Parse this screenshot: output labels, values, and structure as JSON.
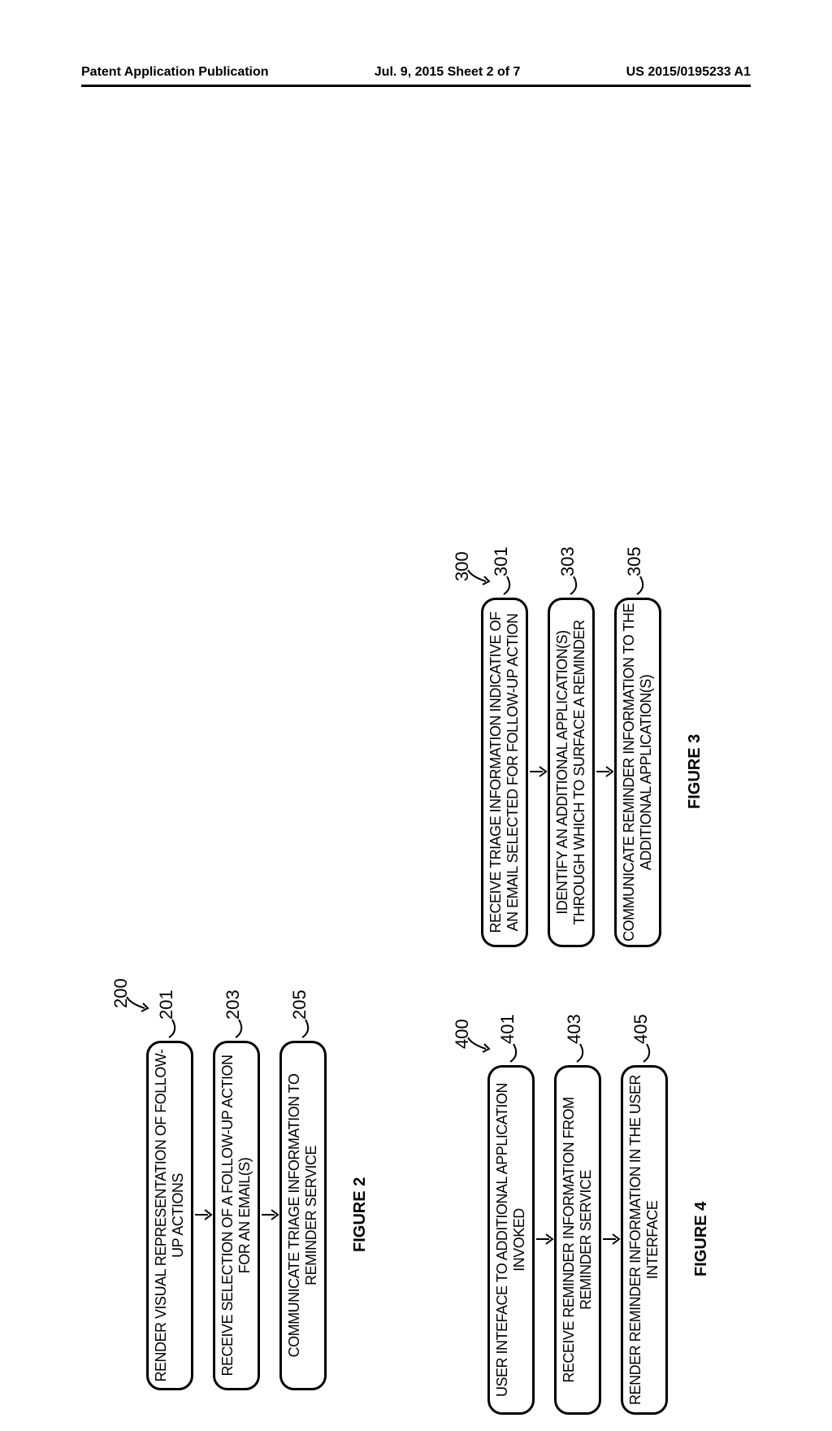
{
  "header": {
    "left": "Patent Application Publication",
    "center": "Jul. 9, 2015  Sheet 2 of 7",
    "right": "US 2015/0195233 A1"
  },
  "fig2": {
    "ref_num": "200",
    "title": "FIGURE 2",
    "steps": [
      {
        "num": "201",
        "text": "RENDER VISUAL REPRESENTATION OF FOLLOW-UP ACTIONS"
      },
      {
        "num": "203",
        "text": "RECEIVE SELECTION OF A FOLLOW-UP ACTION FOR AN EMAIL(S)"
      },
      {
        "num": "205",
        "text": "COMMUNICATE TRIAGE INFORMATION TO REMINDER SERVICE"
      }
    ]
  },
  "fig3": {
    "ref_num": "300",
    "title": "FIGURE 3",
    "steps": [
      {
        "num": "301",
        "text": "RECEIVE TRIAGE INFORMATION INDICATIVE OF AN EMAIL SELECTED FOR FOLLOW-UP ACTION"
      },
      {
        "num": "303",
        "text": "IDENTIFY AN ADDITIONAL APPLICATION(S) THROUGH WHICH TO SURFACE A REMINDER"
      },
      {
        "num": "305",
        "text": "COMMUNICATE REMINDER INFORMATION TO THE ADDITIONAL APPLICATION(S)"
      }
    ]
  },
  "fig4": {
    "ref_num": "400",
    "title": "FIGURE 4",
    "steps": [
      {
        "num": "401",
        "text": "USER INTEFACE TO ADDITIONAL APPLICATION INVOKED"
      },
      {
        "num": "403",
        "text": "RECEIVE REMINDER INFORMATION FROM REMINDER SERVICE"
      },
      {
        "num": "405",
        "text": "RENDER REMINDER INFORMATION IN THE USER INTERFACE"
      }
    ]
  }
}
